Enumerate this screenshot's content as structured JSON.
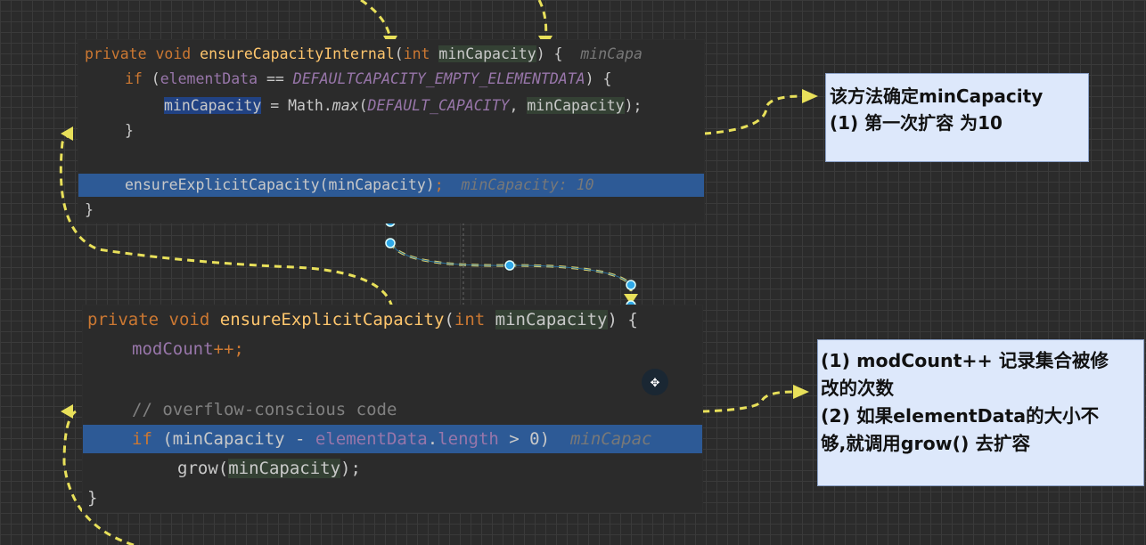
{
  "block1": {
    "line1": {
      "mod": "private",
      "ret": "void",
      "name": "ensureCapacityInternal",
      "ptype": "int",
      "param": "minCapacity",
      "brace": ") {",
      "hint": "minCapa"
    },
    "line2": {
      "kw": "if",
      "open": " (",
      "field": "elementData",
      "op": " == ",
      "const": "DEFAULTCAPACITY_EMPTY_ELEMENTDATA",
      "close": ") {"
    },
    "line3": {
      "var": "minCapacity",
      "mid": " = Math.",
      "method": "max",
      "open": "(",
      "const": "DEFAULT_CAPACITY",
      "sep": ", ",
      "arg": "minCapacity",
      "close": ");"
    },
    "line4": "}",
    "line6": {
      "call": "ensureExplicitCapacity(minCapacity)",
      "semi": ";",
      "hint": "minCapacity: 10"
    },
    "line7": "}"
  },
  "block2": {
    "line1": {
      "mod": "private",
      "ret": "void",
      "name": "ensureExplicitCapacity",
      "ptype": "int",
      "param": "minCapacity",
      "brace": ") {"
    },
    "line2": {
      "field": "modCount",
      "op": "++;"
    },
    "line4": "// overflow-conscious code",
    "line5": {
      "kw": "if",
      "open": " (minCapacity - ",
      "field": "elementData",
      "dot": ".",
      "prop": "length",
      "close": " > 0)",
      "hint": "minCapac"
    },
    "line6": {
      "call": "grow(",
      "arg": "minCapacity",
      "close": ");"
    },
    "line7": "}"
  },
  "note1": {
    "line1": "该方法确定minCapacity",
    "line2": "(1) 第一次扩容 为10"
  },
  "note2": {
    "line1": "(1)  modCount++ 记录集合被修",
    "line2": "改的次数",
    "line3": "(2) 如果elementData的大小不",
    "line4": "够,就调用grow() 去扩容"
  },
  "colors": {
    "arrow": "#e8e05a",
    "highlight": "#2d5a96",
    "note_bg": "#dde8fb",
    "keyword": "#cc7832",
    "method": "#ffc66d",
    "field": "#9876aa"
  },
  "icons": {
    "move": "move-icon",
    "selection_handles": "connector-handle-icon"
  }
}
